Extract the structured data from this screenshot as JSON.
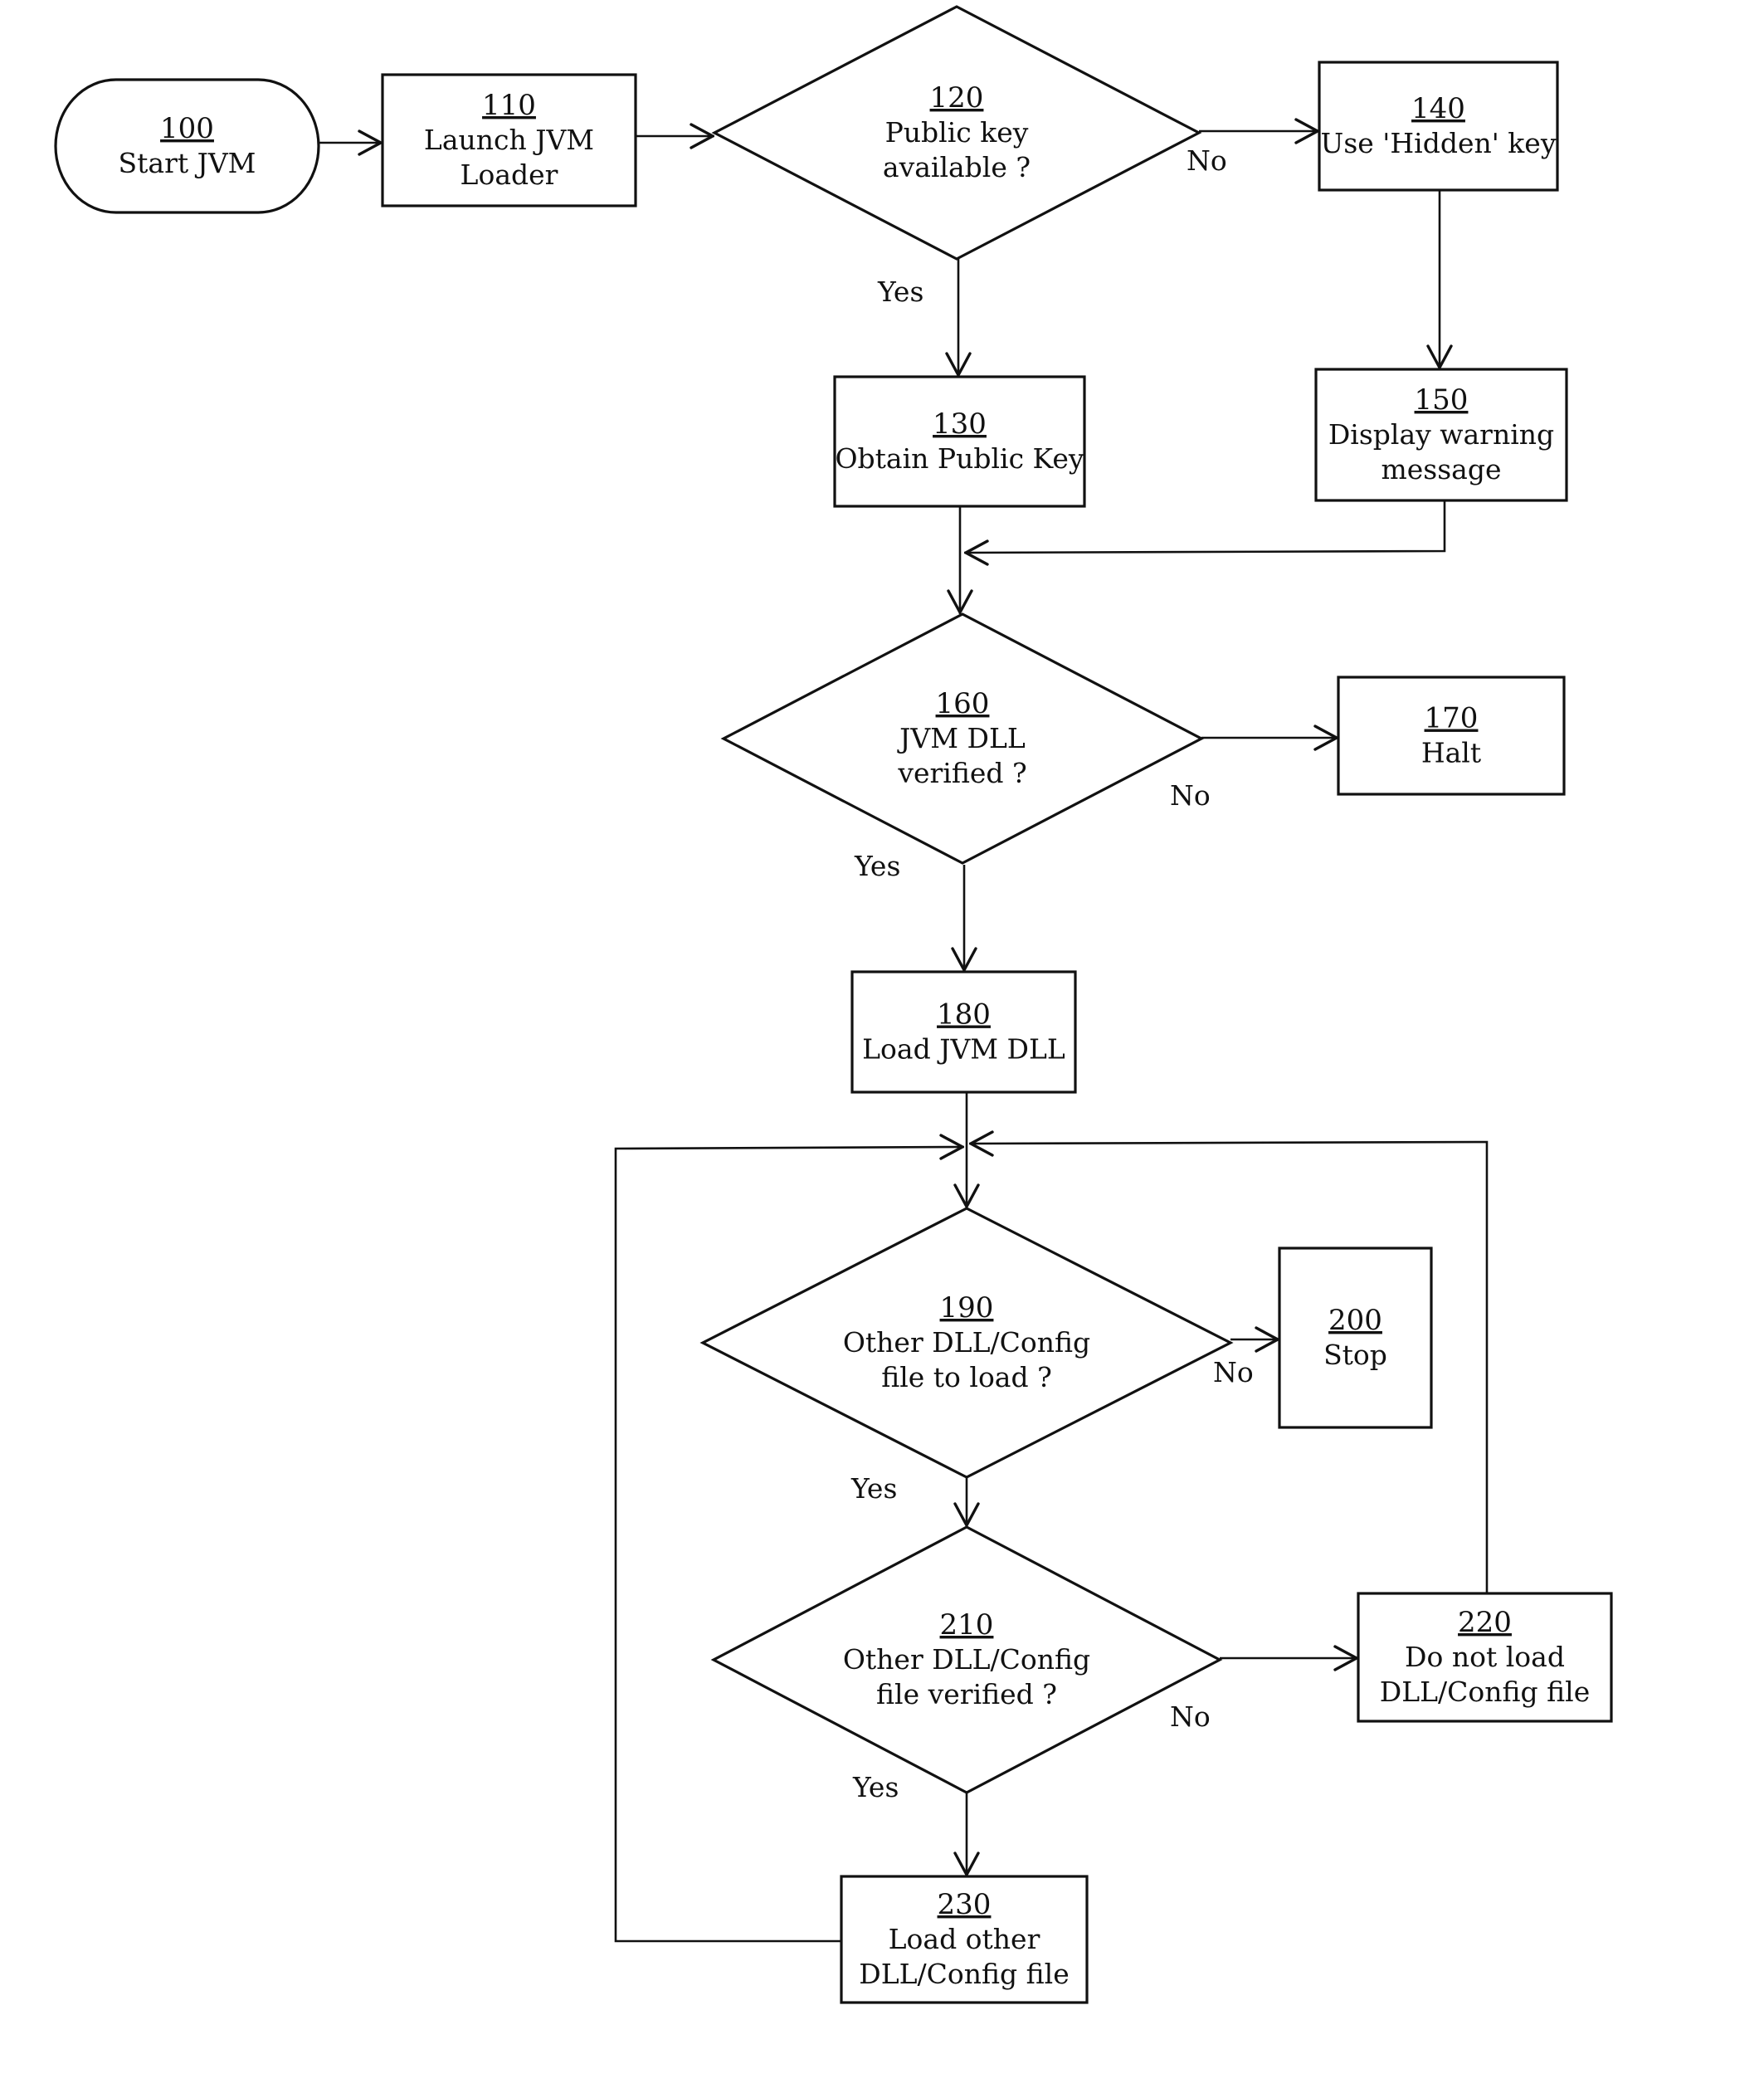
{
  "diagram": {
    "type": "flowchart",
    "nodes": [
      {
        "id": "100",
        "shape": "terminal",
        "ref": "100",
        "lines": [
          "Start JVM"
        ]
      },
      {
        "id": "110",
        "shape": "process",
        "ref": "110",
        "lines": [
          "Launch JVM",
          "Loader"
        ]
      },
      {
        "id": "120",
        "shape": "decision",
        "ref": "120",
        "lines": [
          "Public key",
          "available ?"
        ]
      },
      {
        "id": "130",
        "shape": "process",
        "ref": "130",
        "lines": [
          "Obtain Public Key"
        ]
      },
      {
        "id": "140",
        "shape": "process",
        "ref": "140",
        "lines": [
          "Use 'Hidden' key"
        ]
      },
      {
        "id": "150",
        "shape": "process",
        "ref": "150",
        "lines": [
          "Display warning",
          "message"
        ]
      },
      {
        "id": "160",
        "shape": "decision",
        "ref": "160",
        "lines": [
          "JVM DLL",
          "verified ?"
        ]
      },
      {
        "id": "170",
        "shape": "process",
        "ref": "170",
        "lines": [
          "Halt"
        ]
      },
      {
        "id": "180",
        "shape": "process",
        "ref": "180",
        "lines": [
          "Load JVM DLL"
        ]
      },
      {
        "id": "190",
        "shape": "decision",
        "ref": "190",
        "lines": [
          "Other DLL/Config",
          "file to load ?"
        ]
      },
      {
        "id": "200",
        "shape": "process",
        "ref": "200",
        "lines": [
          "Stop"
        ]
      },
      {
        "id": "210",
        "shape": "decision",
        "ref": "210",
        "lines": [
          "Other DLL/Config",
          "file verified ?"
        ]
      },
      {
        "id": "220",
        "shape": "process",
        "ref": "220",
        "lines": [
          "Do not load",
          "DLL/Config file"
        ]
      },
      {
        "id": "230",
        "shape": "process",
        "ref": "230",
        "lines": [
          "Load other",
          "DLL/Config file"
        ]
      }
    ],
    "edges": [
      {
        "from": "100",
        "to": "110",
        "label": ""
      },
      {
        "from": "110",
        "to": "120",
        "label": ""
      },
      {
        "from": "120",
        "to": "140",
        "label": "No"
      },
      {
        "from": "120",
        "to": "130",
        "label": "Yes"
      },
      {
        "from": "140",
        "to": "150",
        "label": ""
      },
      {
        "from": "150",
        "to": "160",
        "label": ""
      },
      {
        "from": "130",
        "to": "160",
        "label": ""
      },
      {
        "from": "160",
        "to": "170",
        "label": "No"
      },
      {
        "from": "160",
        "to": "180",
        "label": "Yes"
      },
      {
        "from": "180",
        "to": "190",
        "label": ""
      },
      {
        "from": "190",
        "to": "200",
        "label": "No"
      },
      {
        "from": "190",
        "to": "210",
        "label": "Yes"
      },
      {
        "from": "210",
        "to": "220",
        "label": "No"
      },
      {
        "from": "210",
        "to": "230",
        "label": "Yes"
      },
      {
        "from": "220",
        "to": "190",
        "label": ""
      },
      {
        "from": "230",
        "to": "190",
        "label": ""
      }
    ],
    "branch_labels": {
      "yes": "Yes",
      "no": "No"
    }
  }
}
